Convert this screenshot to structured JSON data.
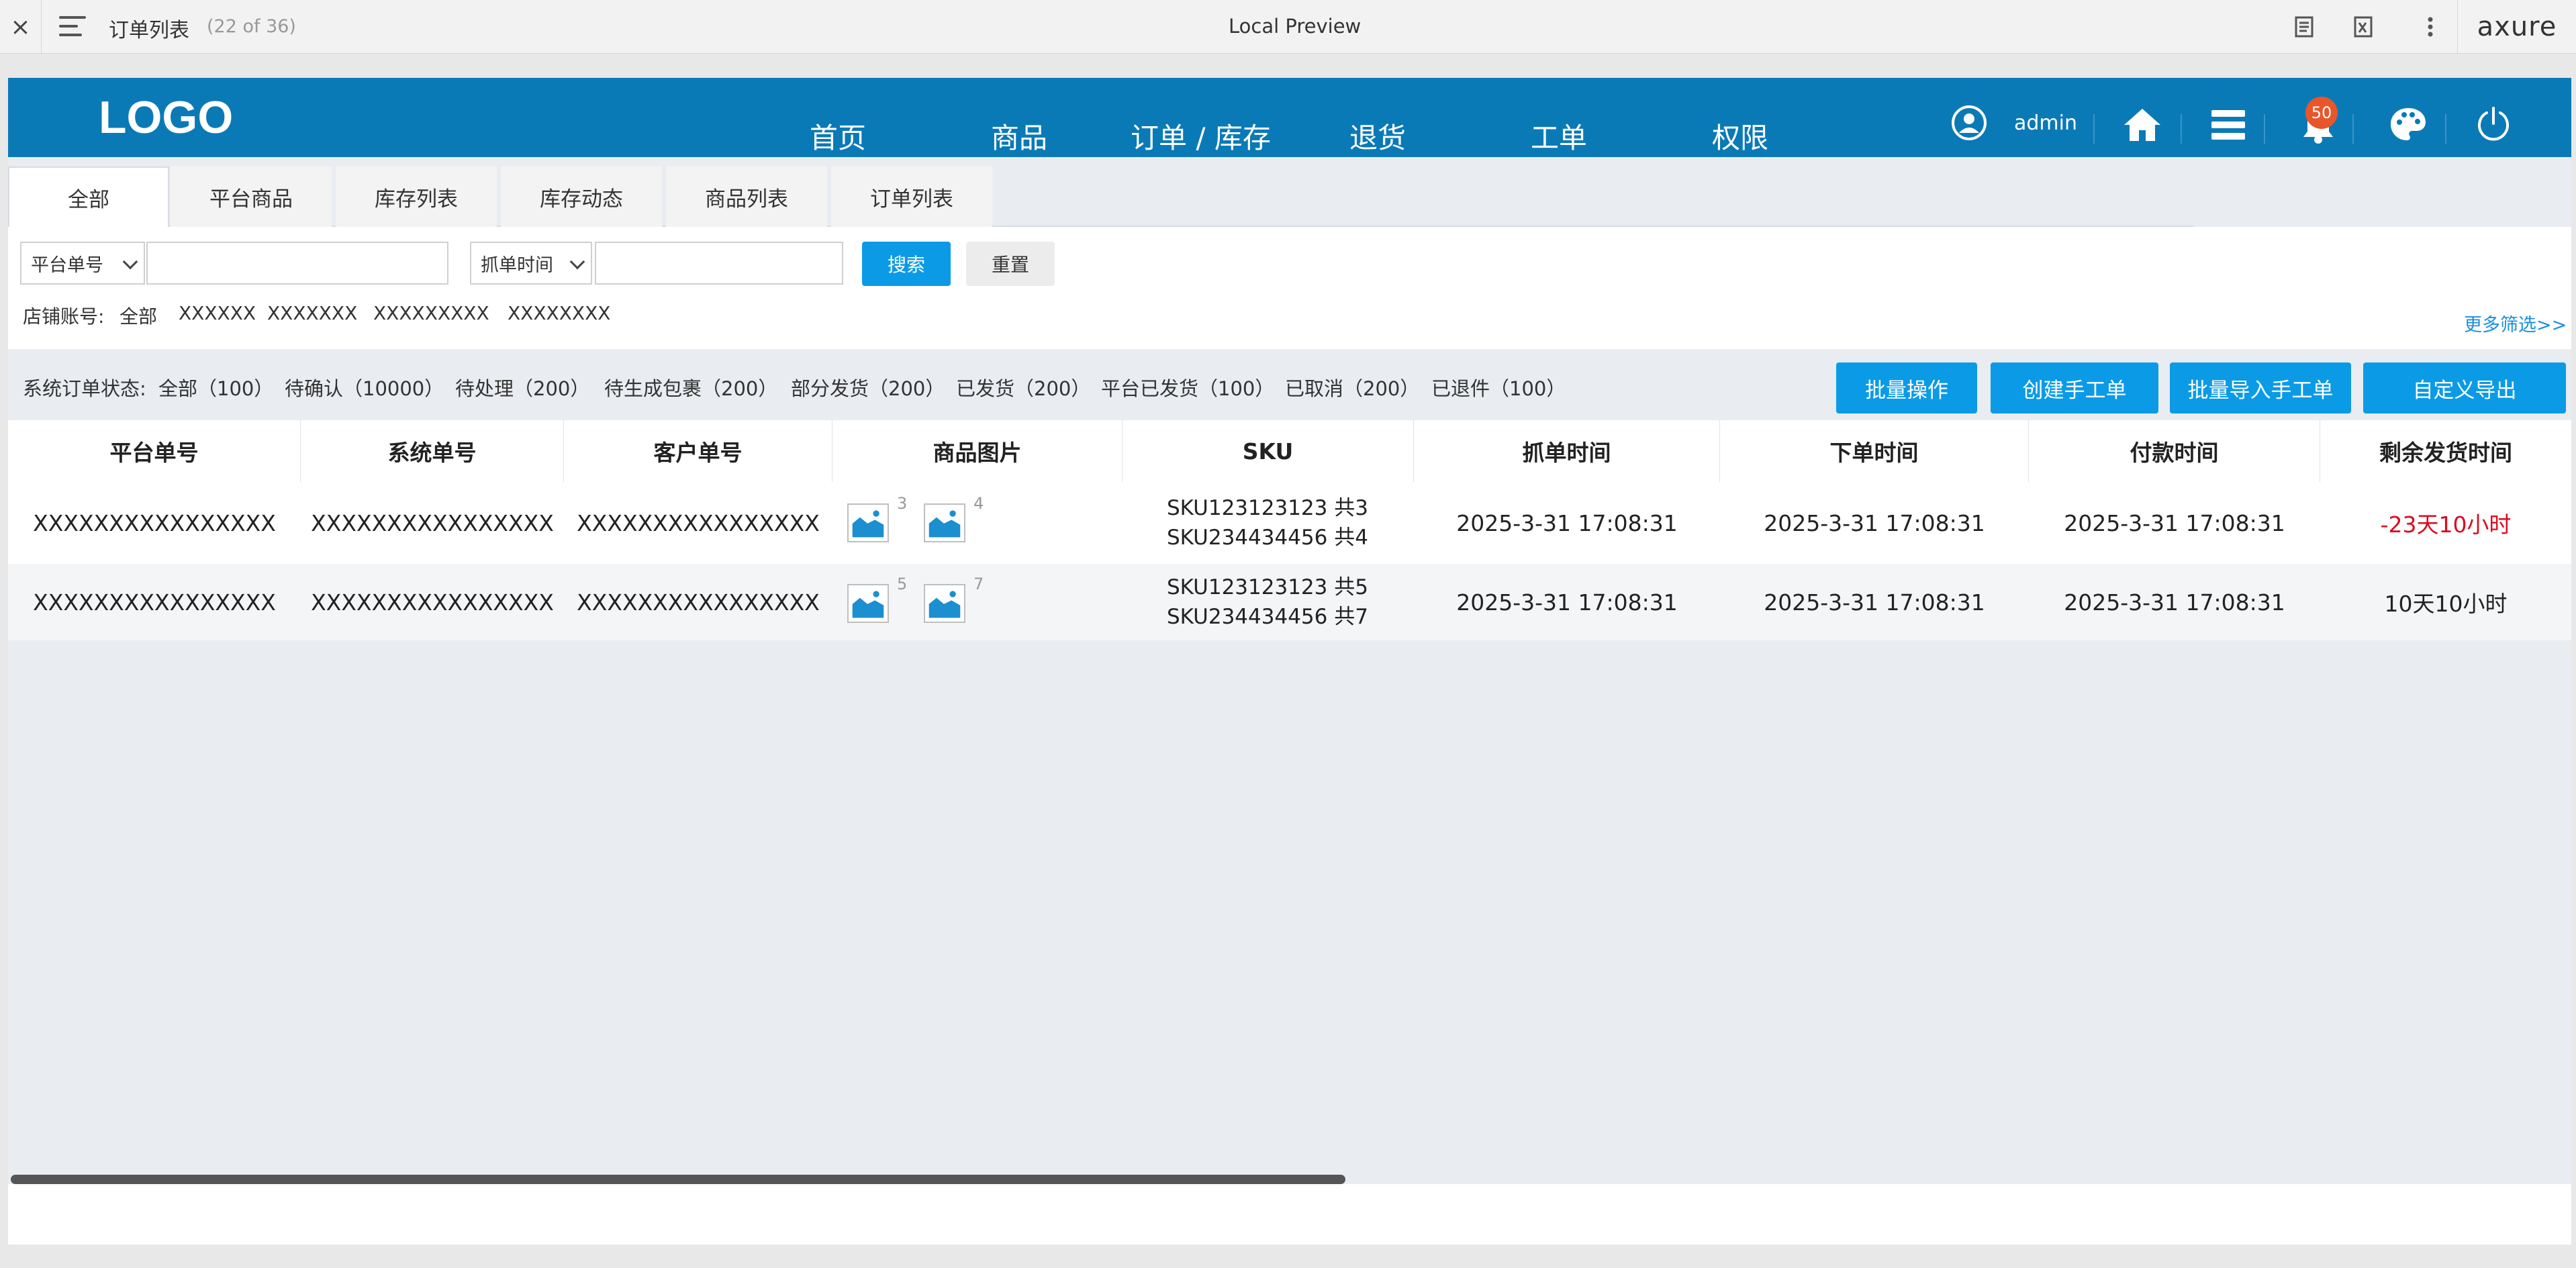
{
  "chrome": {
    "close": "×",
    "page_title": "订单列表",
    "page_count": "(22 of 36)",
    "center_title": "Local Preview",
    "brand": "axure"
  },
  "header": {
    "logo": "LOGO",
    "nav": [
      "首页",
      "商品",
      "订单 / 库存",
      "退货",
      "工单",
      "权限"
    ],
    "user": "admin",
    "notification_count": "50",
    "accent_color": "#0a7ab7"
  },
  "tabs": [
    "全部",
    "平台商品",
    "库存列表",
    "库存动态",
    "商品列表",
    "订单列表"
  ],
  "filters": {
    "field_select": "平台单号",
    "time_select": "抓单时间",
    "search_button": "搜索",
    "reset_button": "重置",
    "shop_label": "店铺账号:",
    "shops": [
      "全部",
      "XXXXXX",
      "XXXXXXX",
      "XXXXXXXXX",
      "XXXXXXXX"
    ],
    "more": "更多筛选>>"
  },
  "status": {
    "label": "系统订单状态:",
    "items": [
      "全部（100）",
      "待确认（10000）",
      "待处理（200）",
      "待生成包裹（200）",
      "部分发货（200）",
      "已发货（200）",
      "平台已发货（100）",
      "已取消（200）",
      "已退件（100）"
    ]
  },
  "actions": [
    "批量操作",
    "创建手工单",
    "批量导入手工单",
    "自定义导出"
  ],
  "table": {
    "columns": [
      "平台单号",
      "系统单号",
      "客户单号",
      "商品图片",
      "SKU",
      "抓单时间",
      "下单时间",
      "付款时间",
      "剩余发货时间"
    ],
    "rows": [
      {
        "platform_no": "XXXXXXXXXXXXXXXX",
        "system_no": "XXXXXXXXXXXXXXXX",
        "customer_no": "XXXXXXXXXXXXXXXX",
        "images": [
          {
            "count": "3"
          },
          {
            "count": "4"
          }
        ],
        "sku": [
          "SKU123123123   共3",
          "SKU234434456   共4"
        ],
        "grab_time": "2025-3-31 17:08:31",
        "order_time": "2025-3-31 17:08:31",
        "pay_time": "2025-3-31 17:08:31",
        "remaining": "-23天10小时",
        "remaining_color": "#d90c1e"
      },
      {
        "platform_no": "XXXXXXXXXXXXXXXX",
        "system_no": "XXXXXXXXXXXXXXXX",
        "customer_no": "XXXXXXXXXXXXXXXX",
        "images": [
          {
            "count": "5"
          },
          {
            "count": "7"
          }
        ],
        "sku": [
          "SKU123123123   共5",
          "SKU234434456   共7"
        ],
        "grab_time": "2025-3-31 17:08:31",
        "order_time": "2025-3-31 17:08:31",
        "pay_time": "2025-3-31 17:08:31",
        "remaining": "10天10小时"
      }
    ]
  }
}
